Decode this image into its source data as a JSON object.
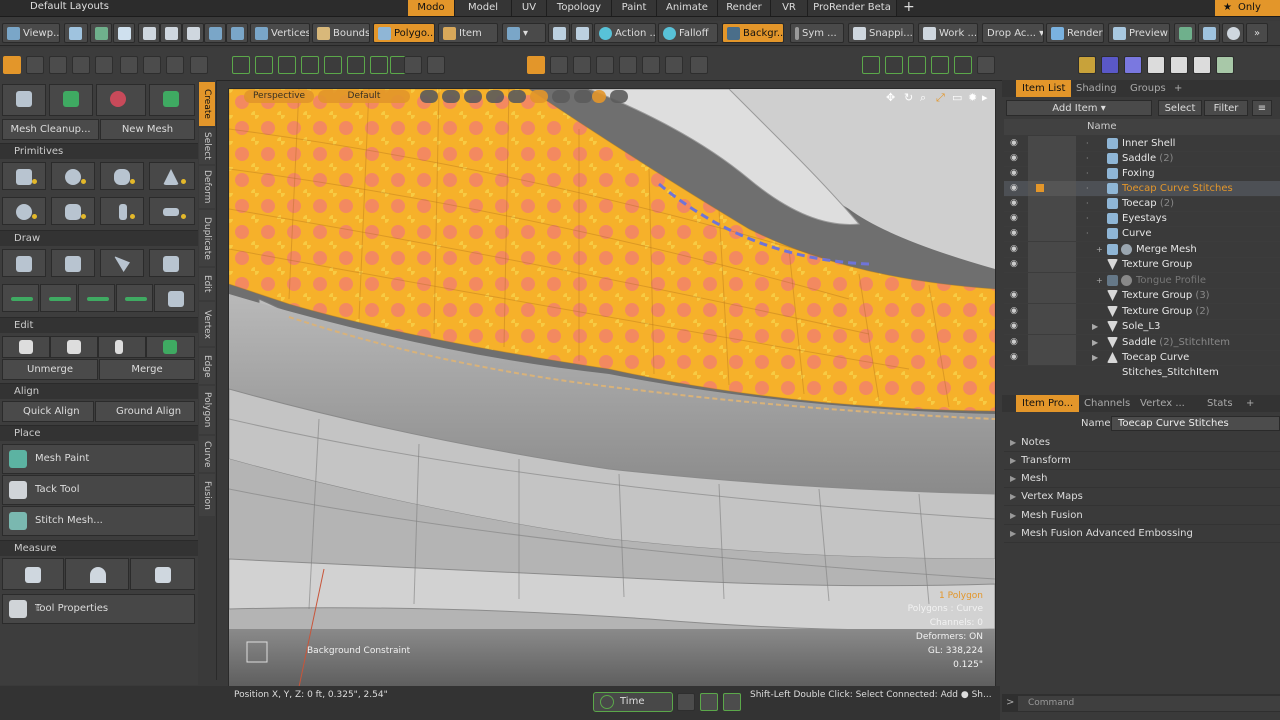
{
  "app": {
    "layout_title": "Default Layouts"
  },
  "workspace_tabs": [
    "Modo",
    "Model",
    "UV",
    "Topology",
    "Paint",
    "Animate",
    "Render",
    "VR",
    "ProRender Beta"
  ],
  "only_label": "Only",
  "toolbar1": {
    "viewport": "Viewp...",
    "vertices": "Vertices",
    "bounds": "Bounds",
    "polygons": "Polygo...",
    "item": "Item",
    "action": "Action ...",
    "falloff": "Falloff",
    "background": "Backgr...",
    "sym": "Sym ...",
    "snapping": "Snappi...",
    "work": "Work ...",
    "drop_action": "Drop Ac...",
    "render": "Render",
    "preview": "Preview"
  },
  "left_panel": {
    "mesh_cleanup": "Mesh Cleanup...",
    "new_mesh": "New Mesh",
    "sections": {
      "primitives": "Primitives",
      "draw": "Draw",
      "edit": "Edit",
      "align": "Align",
      "place": "Place",
      "measure": "Measure"
    },
    "unmerge": "Unmerge",
    "merge": "Merge",
    "quick_align": "Quick Align",
    "ground_align": "Ground Align",
    "mesh_paint": "Mesh Paint",
    "tack_tool": "Tack Tool",
    "stitch_mesh": "Stitch Mesh...",
    "tool_properties": "Tool Properties",
    "tool_properties_key": "K"
  },
  "vertical_tabs": [
    "Create",
    "Select",
    "Deform",
    "Duplicate",
    "Edit",
    "Vertex",
    "Edge",
    "Polygon",
    "Curve",
    "Fusion"
  ],
  "viewport": {
    "camera": "Perspective",
    "style": "Default",
    "stats": {
      "title": "1 Polygon",
      "polygons": "Polygons : Curve",
      "channels": "Channels: 0",
      "deformers": "Deformers: ON",
      "gl": "GL: 338,224",
      "scale": "0.125\""
    },
    "constraint": "Background Constraint"
  },
  "bottom": {
    "position": "Position X, Y, Z:   0 ft, 0.325\", 2.54\"",
    "time": "Time",
    "hint": "Shift-Left Double Click: Select Connected: Add ● Sh..."
  },
  "right_tabs": [
    "Item List",
    "Shading",
    "Groups"
  ],
  "item_list": {
    "add_item": "Add Item",
    "select": "Select",
    "filter": "Filter",
    "name_header": "Name",
    "items": [
      {
        "label": "Inner Shell",
        "suffix": ""
      },
      {
        "label": "Saddle",
        "suffix": "(2)"
      },
      {
        "label": "Foxing",
        "suffix": ""
      },
      {
        "label": "Toecap Curve Stitches",
        "suffix": ""
      },
      {
        "label": "Toecap",
        "suffix": "(2)"
      },
      {
        "label": "Eyestays",
        "suffix": ""
      },
      {
        "label": "Curve",
        "suffix": ""
      },
      {
        "label": "Merge Mesh",
        "suffix": ""
      },
      {
        "label": "Texture Group",
        "suffix": ""
      },
      {
        "label": "Tongue Profile",
        "suffix": ""
      },
      {
        "label": "Texture Group",
        "suffix": "(3)"
      },
      {
        "label": "Texture Group",
        "suffix": "(2)"
      },
      {
        "label": "Sole_L3",
        "suffix": ""
      },
      {
        "label": "Saddle",
        "suffix": "(2)_StitchItem"
      },
      {
        "label": "Toecap Curve Stitches_StitchItem",
        "suffix": ""
      }
    ]
  },
  "properties_tabs": [
    "Item Pro...",
    "Channels",
    "Vertex ...",
    "Stats"
  ],
  "properties": {
    "name_label": "Name",
    "name_value": "Toecap Curve Stitches",
    "groups": [
      "Notes",
      "Transform",
      "Mesh",
      "Vertex Maps",
      "Mesh Fusion",
      "Mesh Fusion Advanced Embossing"
    ]
  },
  "command_placeholder": "Command",
  "colors": {
    "accent": "#e3962a",
    "panel": "#3d3d3d",
    "selection": "#4d5055"
  }
}
